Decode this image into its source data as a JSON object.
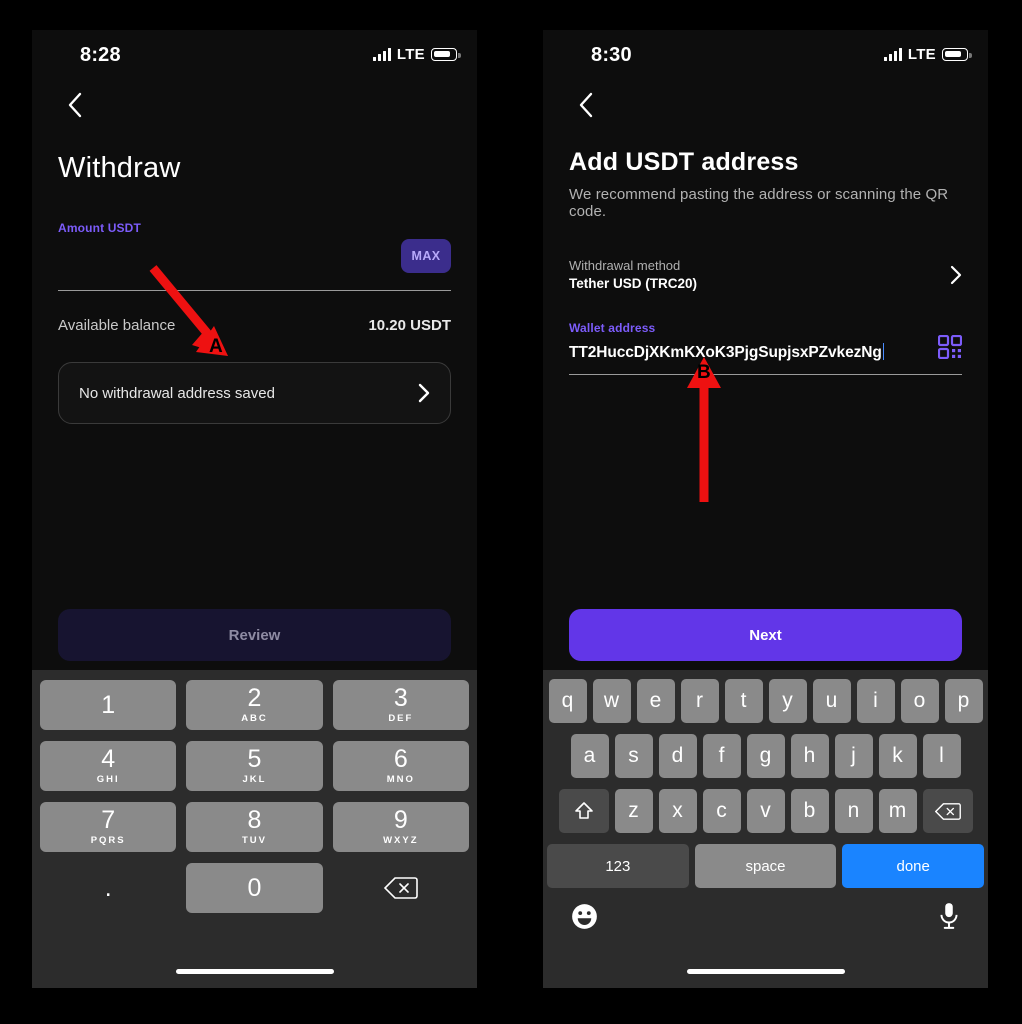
{
  "left_phone": {
    "status_bar": {
      "time": "8:28",
      "network": "LTE",
      "signal_icon": "signal-bars-icon",
      "battery_icon": "battery-icon"
    },
    "back_icon": "chevron-left-icon",
    "title": "Withdraw",
    "amount": {
      "label": "Amount USDT",
      "value": "",
      "max_label": "MAX"
    },
    "balance": {
      "label": "Available balance",
      "value": "10.20 USDT"
    },
    "address_card": {
      "text": "No withdrawal address saved",
      "chevron_icon": "chevron-right-icon"
    },
    "cta": {
      "label": "Review",
      "enabled": false,
      "bg": "#171430",
      "color": "#8e8ba3"
    },
    "keypad": {
      "keys": [
        {
          "digit": "1",
          "sub": ""
        },
        {
          "digit": "2",
          "sub": "ABC"
        },
        {
          "digit": "3",
          "sub": "DEF"
        },
        {
          "digit": "4",
          "sub": "GHI"
        },
        {
          "digit": "5",
          "sub": "JKL"
        },
        {
          "digit": "6",
          "sub": "MNO"
        },
        {
          "digit": "7",
          "sub": "PQRS"
        },
        {
          "digit": "8",
          "sub": "TUV"
        },
        {
          "digit": "9",
          "sub": "WXYZ"
        },
        {
          "digit": ".",
          "sub": ""
        },
        {
          "digit": "0",
          "sub": ""
        },
        {
          "digit": "",
          "sub": "",
          "icon": "backspace-icon"
        }
      ]
    }
  },
  "right_phone": {
    "status_bar": {
      "time": "8:30",
      "network": "LTE",
      "signal_icon": "signal-bars-icon",
      "battery_icon": "battery-icon"
    },
    "back_icon": "chevron-left-icon",
    "title": "Add USDT address",
    "subtitle": "We recommend pasting the address or scanning the QR code.",
    "withdrawal_method": {
      "label": "Withdrawal method",
      "value": "Tether USD (TRC20)",
      "chevron_icon": "chevron-right-icon"
    },
    "wallet_address": {
      "label": "Wallet address",
      "value": "TT2HuccDjXKmKXoK3PjgSupjsxPZvkezNg",
      "qr_icon": "qr-code-scan-icon"
    },
    "cta": {
      "label": "Next",
      "enabled": true,
      "bg": "#6236e8",
      "color": "#ffffff"
    },
    "keyboard": {
      "row1": [
        "q",
        "w",
        "e",
        "r",
        "t",
        "y",
        "u",
        "i",
        "o",
        "p"
      ],
      "row2": [
        "a",
        "s",
        "d",
        "f",
        "g",
        "h",
        "j",
        "k",
        "l"
      ],
      "row3": [
        "z",
        "x",
        "c",
        "v",
        "b",
        "n",
        "m"
      ],
      "shift_icon": "shift-arrow-icon",
      "backspace_icon": "backspace-icon",
      "numbers_label": "123",
      "space_label": "space",
      "done_label": "done",
      "emoji_icon": "emoji-smiley-icon",
      "mic_icon": "microphone-icon"
    }
  },
  "annotations": {
    "color": "#ee1111",
    "markers": [
      {
        "id": "A",
        "label": "A",
        "target": "amount-input-field"
      },
      {
        "id": "B",
        "label": "B",
        "target": "wallet-address-input"
      }
    ]
  }
}
